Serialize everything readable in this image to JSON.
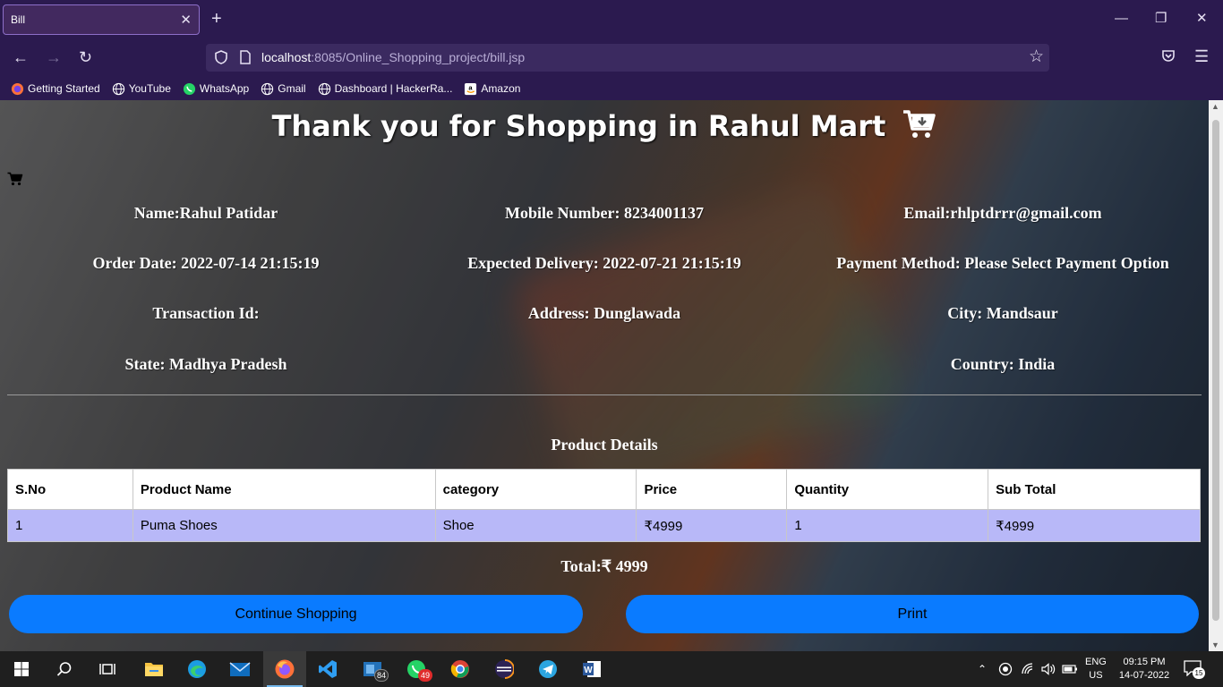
{
  "browser": {
    "tab_title": "Bill",
    "url_host": "localhost",
    "url_rest": ":8085/Online_Shopping_project/bill.jsp",
    "bookmarks": [
      "Getting Started",
      "YouTube",
      "WhatsApp",
      "Gmail",
      "Dashboard | HackerRa...",
      "Amazon"
    ]
  },
  "page": {
    "title": "Thank you for Shopping in Rahul Mart",
    "info": {
      "name": "Name:Rahul Patidar",
      "mobile": "Mobile Number: 8234001137",
      "email": "Email:rhlptdrrr@gmail.com",
      "order_date": "Order Date: 2022-07-14 21:15:19",
      "expected_delivery": "Expected Delivery: 2022-07-21 21:15:19",
      "payment_method": "Payment Method: Please Select Payment Option",
      "transaction_id": "Transaction Id:",
      "address": "Address: Dunglawada",
      "city": "City: Mandsaur",
      "state": "State: Madhya Pradesh",
      "country": "Country: India"
    },
    "product_details_title": "Product Details",
    "table": {
      "headers": [
        "S.No",
        "Product Name",
        "category",
        "Price",
        "Quantity",
        "Sub Total"
      ],
      "rows": [
        [
          "1",
          "Puma Shoes",
          "Shoe",
          "₹4999",
          "1",
          "₹4999"
        ]
      ]
    },
    "total": "Total:₹ 4999",
    "continue_label": "Continue Shopping",
    "print_label": "Print"
  },
  "taskbar": {
    "mail_badge": "84",
    "whatsapp_badge": "49",
    "lang_line1": "ENG",
    "lang_line2": "US",
    "time": "09:15 PM",
    "date": "14-07-2022",
    "notifications": "15"
  },
  "colors": {
    "accent_button": "#0a7bff",
    "row_bg": "#b8b8f8",
    "browser_chrome": "#2b1a4f"
  }
}
